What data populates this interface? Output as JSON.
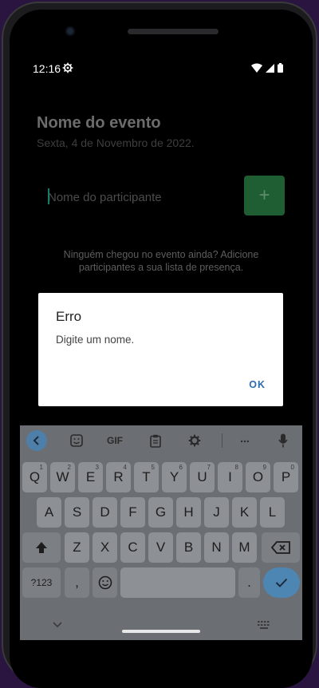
{
  "status": {
    "time": "12:16"
  },
  "event": {
    "title": "Nome do evento",
    "date": "Sexta, 4 de Novembro de 2022."
  },
  "form": {
    "name_placeholder": "Nome do participante",
    "add_label": "+"
  },
  "empty_message": "Ninguém chegou no evento ainda? Adicione participantes a sua lista de presença.",
  "dialog": {
    "title": "Erro",
    "message": "Digite um nome.",
    "ok_label": "OK"
  },
  "keyboard": {
    "gif_label": "GIF",
    "more_label": "...",
    "row1": [
      {
        "k": "Q",
        "h": "1"
      },
      {
        "k": "W",
        "h": "2"
      },
      {
        "k": "E",
        "h": "3"
      },
      {
        "k": "R",
        "h": "4"
      },
      {
        "k": "T",
        "h": "5"
      },
      {
        "k": "Y",
        "h": "6"
      },
      {
        "k": "U",
        "h": "7"
      },
      {
        "k": "I",
        "h": "8"
      },
      {
        "k": "O",
        "h": "9"
      },
      {
        "k": "P",
        "h": "0"
      }
    ],
    "row2": [
      "A",
      "S",
      "D",
      "F",
      "G",
      "H",
      "J",
      "K",
      "L"
    ],
    "row3": [
      "Z",
      "X",
      "C",
      "V",
      "B",
      "N",
      "M"
    ],
    "symbols_label": "?123",
    "comma_label": ",",
    "period_label": "."
  },
  "colors": {
    "accent_green": "#1f5d33",
    "dialog_button": "#2b6cb0",
    "keyboard_bg": "#6b6e73"
  }
}
